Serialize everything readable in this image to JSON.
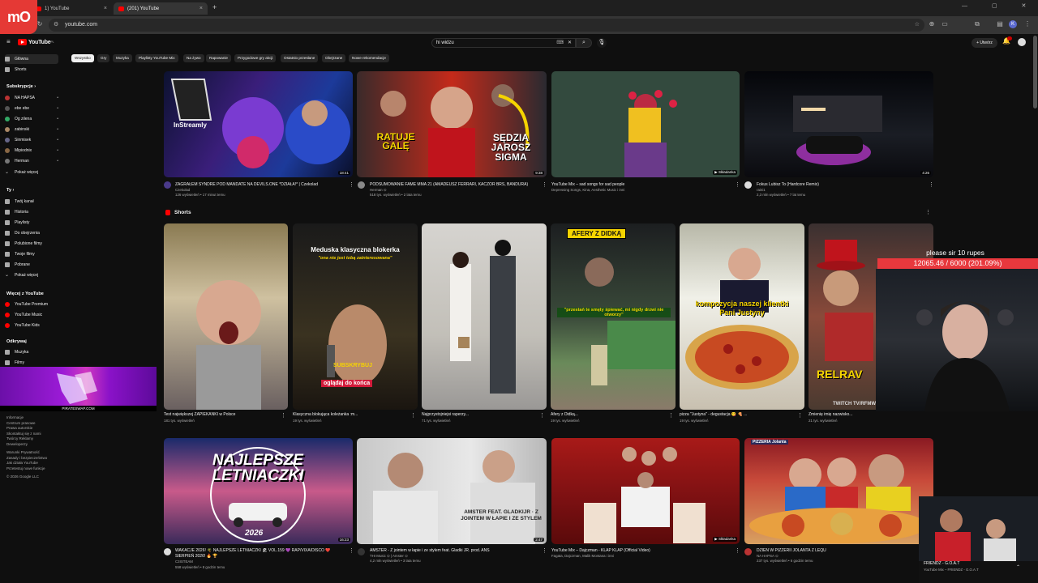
{
  "browser": {
    "tabs": [
      {
        "title": "1) YouTube",
        "active": false
      },
      {
        "title": "(201) YouTube",
        "active": true
      }
    ],
    "url": "youtube.com",
    "logo_badge": "mO",
    "new_tab": "+"
  },
  "header": {
    "logo": "YouTube",
    "logo_region": "PL",
    "search_value": "hi widzu",
    "create_label": "+ Utwórz",
    "profile_initial": "K"
  },
  "sidebar": {
    "main": [
      {
        "label": "Główna",
        "icon": "home-icon"
      },
      {
        "label": "Shorts",
        "icon": "shorts-icon"
      }
    ],
    "subs_header": "Subskrypcje ›",
    "subs": [
      "NA HAPSA",
      "ebe ebe",
      "Og zilena",
      "zabinski",
      "Sinmisek",
      "Mipiodnix",
      "Herman"
    ],
    "subs_more": "Pokaż więcej",
    "you_header": "Ty ›",
    "you": [
      {
        "label": "Twój kanał",
        "icon": "channel-icon"
      },
      {
        "label": "Historia",
        "icon": "history-icon"
      },
      {
        "label": "Playlisty",
        "icon": "playlist-icon"
      },
      {
        "label": "Do obejrzenia",
        "icon": "watch-later-icon"
      },
      {
        "label": "Polubione filmy",
        "icon": "like-icon"
      },
      {
        "label": "Twoje filmy",
        "icon": "video-icon"
      },
      {
        "label": "Pobrane",
        "icon": "download-icon"
      },
      {
        "label": "Pokaż więcej",
        "icon": "chevron-down-icon"
      }
    ],
    "more_header": "Więcej z YouTube",
    "more": [
      "YouTube Premium",
      "YouTube Music",
      "YouTube Kids"
    ],
    "explore_header": "Odkrywaj",
    "explore": [
      "Muzyka",
      "Filmy"
    ],
    "promo_label": "PIRATESWAP.COM",
    "footer_lines": [
      "Informacje",
      "Centrum prasowe",
      "Prawa autorskie",
      "Skontaktuj się z nami",
      "Twórcy   Reklamy",
      "Deweloperzy",
      "",
      "Warunki   Prywatność",
      "Zasady i bezpieczeństwo",
      "Jak działa YouTube",
      "Przetestuj nowe funkcje",
      "",
      "© 2026 Google LLC"
    ]
  },
  "chips": [
    "Wszystko",
    "Gry",
    "Muzyka",
    "Playlisty YouTube Mix",
    "Na żywo",
    "Rapowanie",
    "Przygodowe gry akcji",
    "Ostatnio przesłane",
    "Obejrzane",
    "Nowe rekomendacje"
  ],
  "videos_row1": [
    {
      "title": "ZAGRAŁEM SYNDRE POD MANDATE NA DEVILS.ONE *DZIAŁA!* | Czekolad",
      "channel": "Czekolad",
      "meta": "126 wyświetleń • 17 minut temu",
      "duration": "18:41",
      "thumb_text": "InStreamly"
    },
    {
      "title": "PODSUMOWANIE FAME MMA 21 (AMADEUSZ FERRARI, KACZOR BRS, BANDURA)",
      "channel": "Herman ⊙",
      "meta": "518 tys. wyświetleń • 2 lata temu",
      "duration": "9:38",
      "thumb_text_left": "RATUJE GALĘ",
      "thumb_text_right": "SĘDZIA JAROSZ SIGMA"
    },
    {
      "title": "YouTube Mix – sad songs for sad people",
      "channel": "Depressing Songs, Kina, Aesthetic Music i inni",
      "meta": "",
      "duration": "▶ Składanka"
    },
    {
      "title": "Fokus Lubisz To (Hardcore Remix)",
      "channel": "raini1",
      "meta": "2,3 mln wyświetleń • 7 lat temu",
      "duration": "4:26"
    }
  ],
  "shorts": {
    "header": "Shorts",
    "items": [
      {
        "title": "Test największej ZAPIEKANKI w Polsce",
        "meta": "181 tys. wyświetleń"
      },
      {
        "title": "Klasyczna blokująca koleżanka :m...",
        "meta": "19 tys. wyświetleń",
        "overlay_title": "Meduska klasyczna blokerka",
        "overlay_sub": "\"ona nie jest tobą zainteresowana\"",
        "overlay_cta": "SUBSKRYBUJ",
        "overlay_bottom": "oglądaj do końca"
      },
      {
        "title": "Najprzystojniejsi raperzy...",
        "meta": "71 tys. wyświetleń"
      },
      {
        "title": "Afery z Didką...",
        "meta": "19 tys. wyświetleń",
        "overlay_title": "AFERY Z DIDKĄ",
        "overlay_sub": "\"przestań te smęty śpiewać, mi nigdy drzwi nie otworzy\""
      },
      {
        "title": "pizza \"Justyna\" - degustacja 😋 🍕 ...",
        "meta": "19 tys. wyświetleń",
        "overlay_title": "kompozycja naszej klientki Pani Justyny"
      },
      {
        "title": "Zmienię imię nazwisko...",
        "meta": "21 tys. wyświetleń",
        "overlay_title": "RELRAV",
        "overlay_sub": "TWITCH TV/RFMWA"
      }
    ]
  },
  "videos_row2": [
    {
      "title": "WAKACJE 2026! 🌴 NAJLEPSZE LETNIACZKI 🏖 VOL.159 💜 RAP/VIXA/DISCO ❤️ SIERPIEŃ 2026! 🔥 🏆",
      "channel": "C3ISTEAM",
      "meta": "558 wyświetleń • 8 godzin temu",
      "duration": "16:23",
      "thumb_text": "NAJLEPSZE LETNIACZKI",
      "thumb_year": "2026"
    },
    {
      "title": "AMSTER - Z jointem w łapie i ze stylem feat. Gladki JR. prod. ANS",
      "channel": "THI Music ⊙ | Amster ⊙",
      "meta": "4,2 mln wyświetleń • 3 lata temu",
      "duration": "2:47",
      "thumb_text": "AMSTER FEAT. GLADKIJR · Z JOINTEM W ŁAPIE I ZE STYLEM"
    },
    {
      "title": "YouTube Mix – Dajczman - KLAP KLAP (Official Video)",
      "channel": "Fagata, Dajczman, Malik Montana i inni",
      "meta": "",
      "duration": "▶ Składanka"
    },
    {
      "title": "DZIEŃ W PIZZERII JOLANTA Z LEQU",
      "channel": "NA HAPSA ⊙",
      "meta": "237 tys. wyświetleń • 6 godzin temu",
      "duration": "",
      "thumb_text": "PIZZERIA Jolanta"
    }
  ],
  "stream": {
    "donation_label": "please sir 10 rupes",
    "donation_progress": "12065.46 / 6000 (201.09%)",
    "mini_title": "FRIENDZ - G.O.A.T",
    "mini_sub": "YouTube Mix – FRIENDZ - G.O.A.T",
    "mini_caret": "⌃"
  }
}
